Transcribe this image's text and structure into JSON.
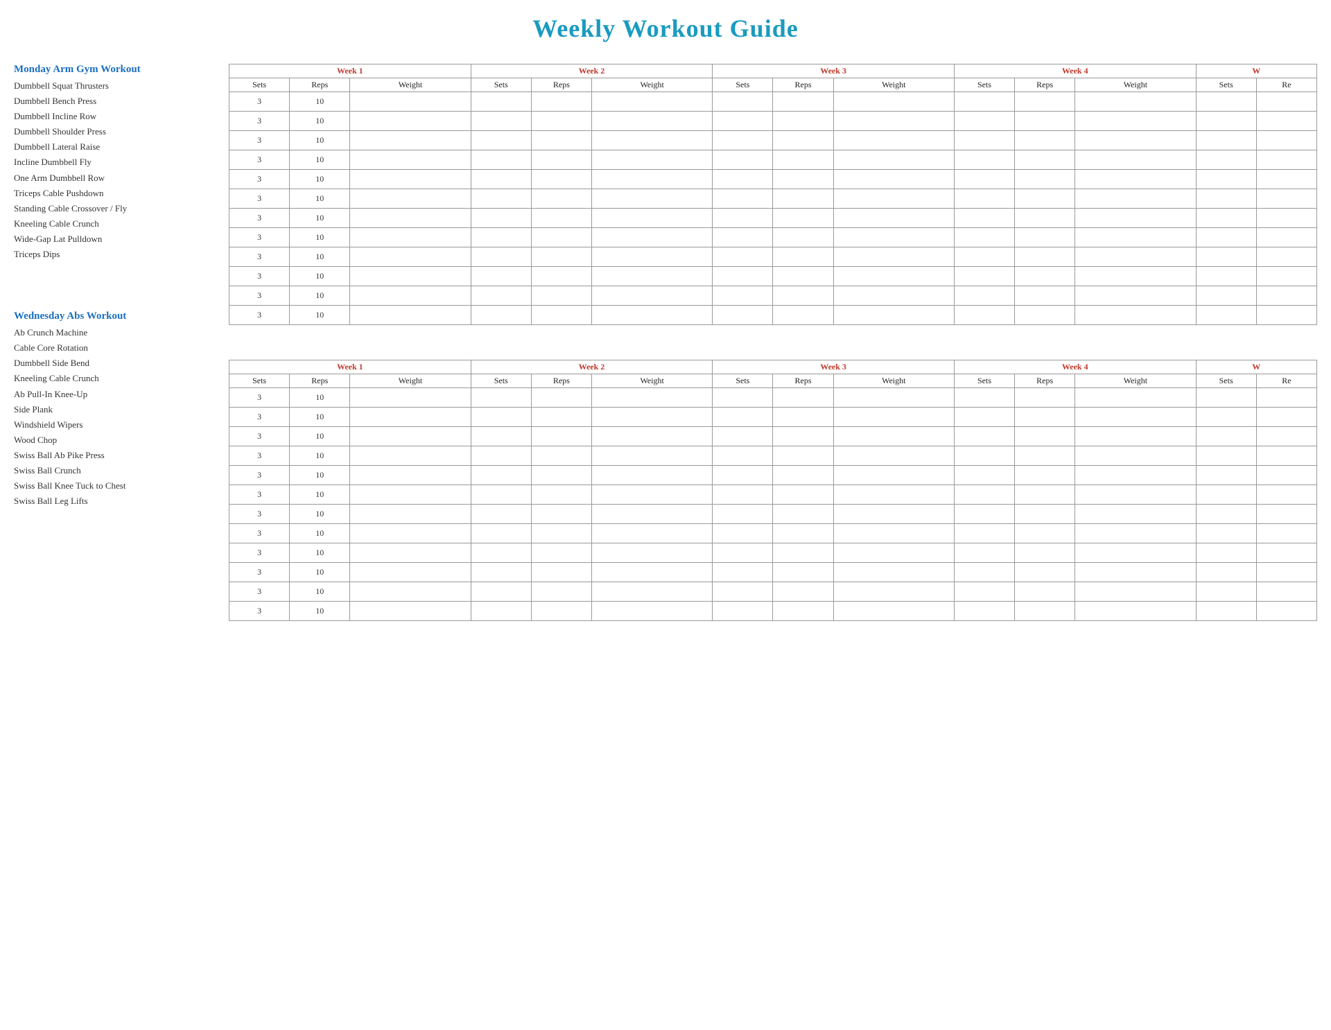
{
  "title": "Weekly Workout Guide",
  "section1": {
    "title": "Monday Arm Gym Workout",
    "exercises": [
      "Dumbbell Squat Thrusters",
      "Dumbbell Bench Press",
      "Dumbbell Incline Row",
      "Dumbbell Shoulder Press",
      "Dumbbell Lateral Raise",
      "Incline Dumbbell Fly",
      "One Arm Dumbbell Row",
      "Triceps Cable Pushdown",
      "Standing Cable Crossover / Fly",
      "Kneeling Cable Crunch",
      "Wide-Gap Lat Pulldown",
      "Triceps Dips"
    ],
    "default_sets": "3",
    "default_reps": "10"
  },
  "section2": {
    "title": "Wednesday Abs Workout",
    "exercises": [
      "Ab Crunch Machine",
      "Cable Core Rotation",
      "Dumbbell Side Bend",
      "Kneeling Cable Crunch",
      "Ab Pull-In Knee-Up",
      "Side Plank",
      "Windshield Wipers",
      "Wood Chop",
      "Swiss Ball Ab Pike Press",
      "Swiss Ball Crunch",
      "Swiss Ball Knee Tuck to Chest",
      "Swiss Ball Leg Lifts"
    ],
    "default_sets": "3",
    "default_reps": "10"
  },
  "weeks": [
    "Week 1",
    "Week 2",
    "Week 3",
    "Week 4",
    "W"
  ],
  "sub_headers": [
    "Sets",
    "Reps",
    "Weight"
  ]
}
